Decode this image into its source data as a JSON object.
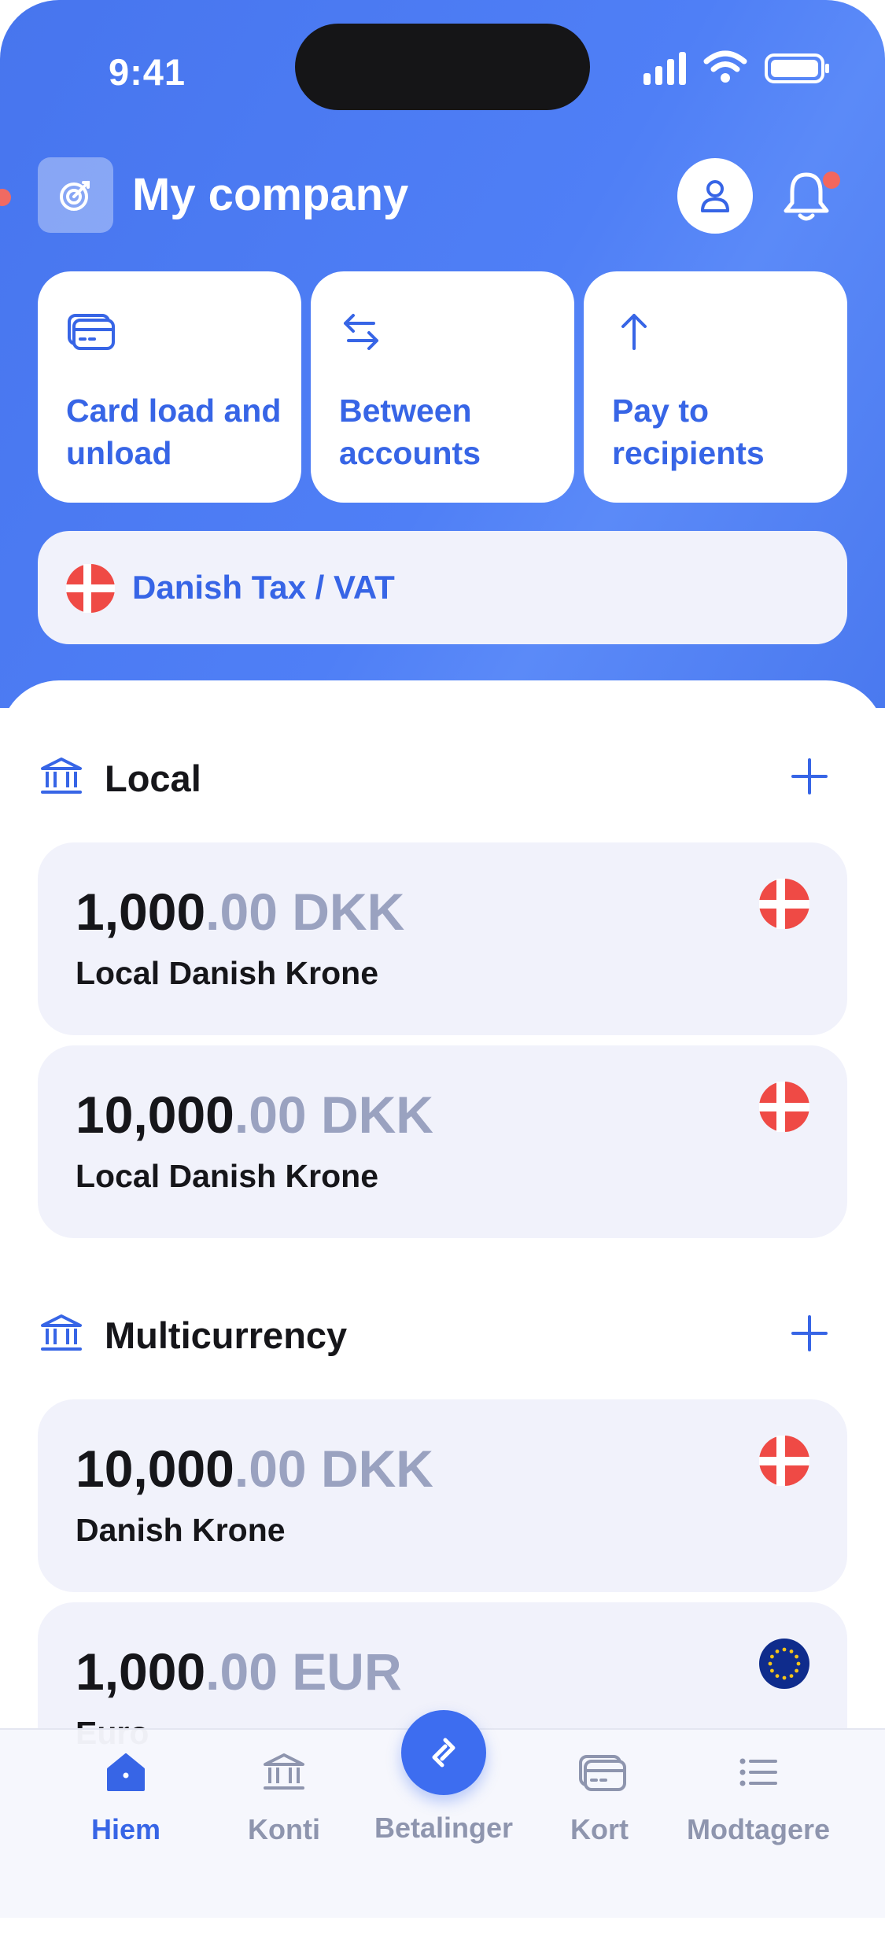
{
  "status_bar": {
    "time": "9:41"
  },
  "header": {
    "company": "My company"
  },
  "quick_actions": [
    {
      "label": "Card load and unload",
      "icon": "card-icon"
    },
    {
      "label": "Between accounts",
      "icon": "transfer-arrows-icon"
    },
    {
      "label": "Pay to recipients",
      "icon": "arrow-up-icon"
    }
  ],
  "tax": {
    "label": "Danish Tax / VAT",
    "icon": "denmark-flag-icon"
  },
  "sections": [
    {
      "title": "Local",
      "accounts": [
        {
          "amount_int": "1,000",
          "amount_dec": ".00 DKK",
          "name": "Local Danish Krone",
          "flag": "denmark-flag-icon"
        },
        {
          "amount_int": "10,000",
          "amount_dec": ".00 DKK",
          "name": "Local Danish Krone",
          "flag": "denmark-flag-icon"
        }
      ]
    },
    {
      "title": "Multicurrency",
      "accounts": [
        {
          "amount_int": "10,000",
          "amount_dec": ".00 DKK",
          "name": "Danish Krone",
          "flag": "denmark-flag-icon"
        },
        {
          "amount_int": "1,000",
          "amount_dec": ".00 EUR",
          "name": "Euro",
          "flag": "eu-flag-icon"
        }
      ]
    }
  ],
  "tabbar": {
    "items": [
      {
        "label": "Hiem",
        "icon": "home-icon",
        "active": true
      },
      {
        "label": "Konti",
        "icon": "bank-icon",
        "active": false
      },
      {
        "label": "Betalinger",
        "icon": "payments-icon",
        "active": false
      },
      {
        "label": "Kort",
        "icon": "card-icon",
        "active": false
      },
      {
        "label": "Modtagere",
        "icon": "list-icon",
        "active": false
      }
    ]
  },
  "colors": {
    "header_blue": "#4775ee",
    "accent": "#3765e6",
    "card_bg": "#f1f2fb",
    "muted_text": "#9aa2c0",
    "flag_red": "#ef4a45",
    "eu_blue": "#0f2c8c"
  }
}
